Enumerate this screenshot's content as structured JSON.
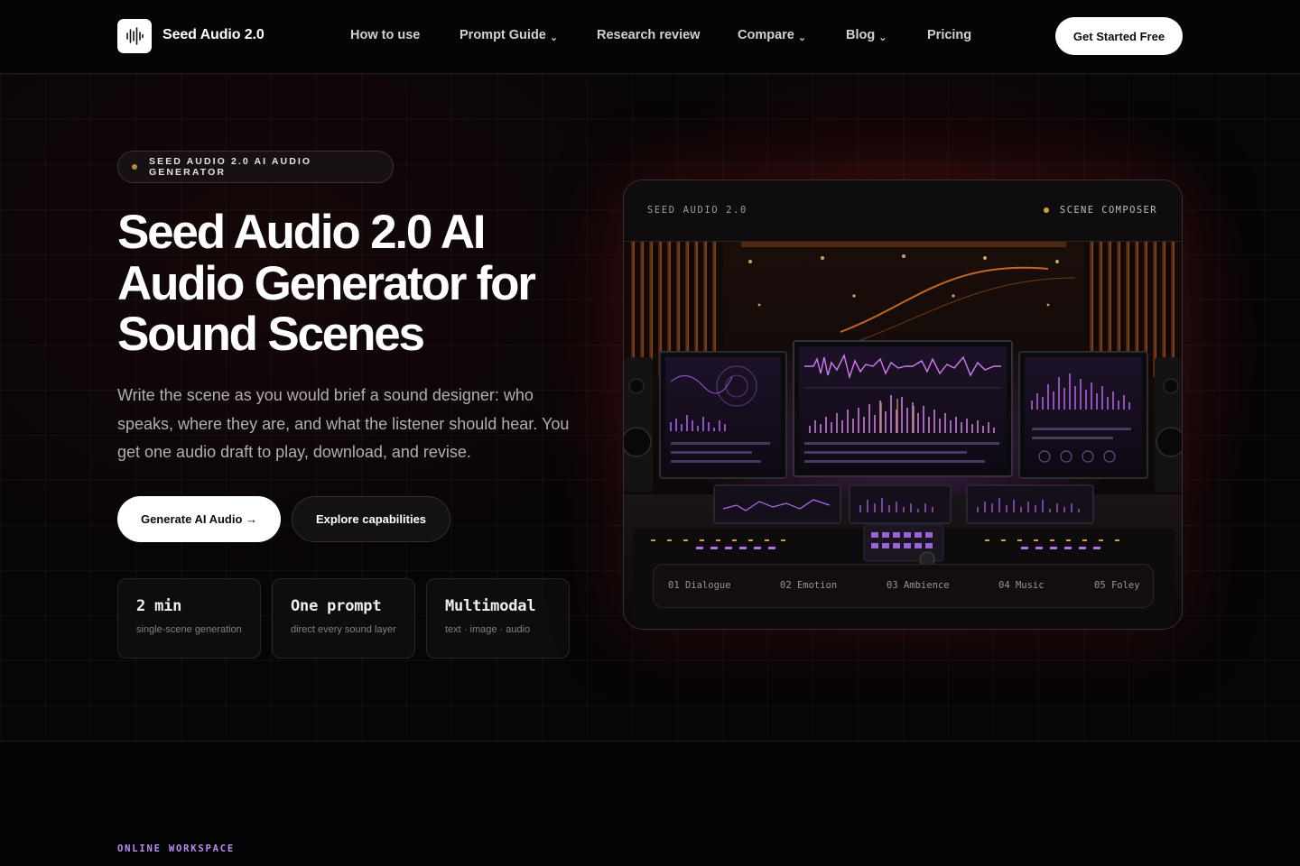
{
  "nav": {
    "brand": "Seed Audio 2.0",
    "links": [
      {
        "label": "How to use",
        "dropdown": false
      },
      {
        "label": "Prompt Guide",
        "dropdown": true
      },
      {
        "label": "Research review",
        "dropdown": false
      },
      {
        "label": "Compare",
        "dropdown": true
      },
      {
        "label": "Blog",
        "dropdown": true
      },
      {
        "label": "Pricing",
        "dropdown": false
      }
    ],
    "chevron": "⌄",
    "cta": "Get Started Free"
  },
  "hero": {
    "badge": "SEED AUDIO 2.0 AI AUDIO GENERATOR",
    "title_lines": [
      "Seed Audio 2.0 AI",
      "Audio Generator for",
      "Sound Scenes"
    ],
    "description": "Write the scene as you would brief a sound designer: who speaks, where they are, and what the listener should hear. You get one audio draft to play, download, and revise.",
    "primary_button": "Generate AI Audio →",
    "secondary_button": "Explore capabilities",
    "stats": [
      {
        "value": "2 min",
        "label": "single-scene generation"
      },
      {
        "value": "One prompt",
        "label": "direct every sound layer"
      },
      {
        "value": "Multimodal",
        "label": "text · image · audio"
      }
    ]
  },
  "panel": {
    "title": "SEED AUDIO 2.0",
    "status": "SCENE COMPOSER",
    "steps": [
      "01 Dialogue",
      "02 Emotion",
      "03 Ambience",
      "04 Music",
      "05 Foley"
    ]
  },
  "section2": {
    "eyebrow": "ONLINE WORKSPACE"
  },
  "colors": {
    "accent_gold": "#d39b45",
    "accent_purple": "#b98ef0",
    "background": "#050405"
  },
  "icons": {
    "logo": "waveform-icon",
    "status": "dot-icon"
  }
}
